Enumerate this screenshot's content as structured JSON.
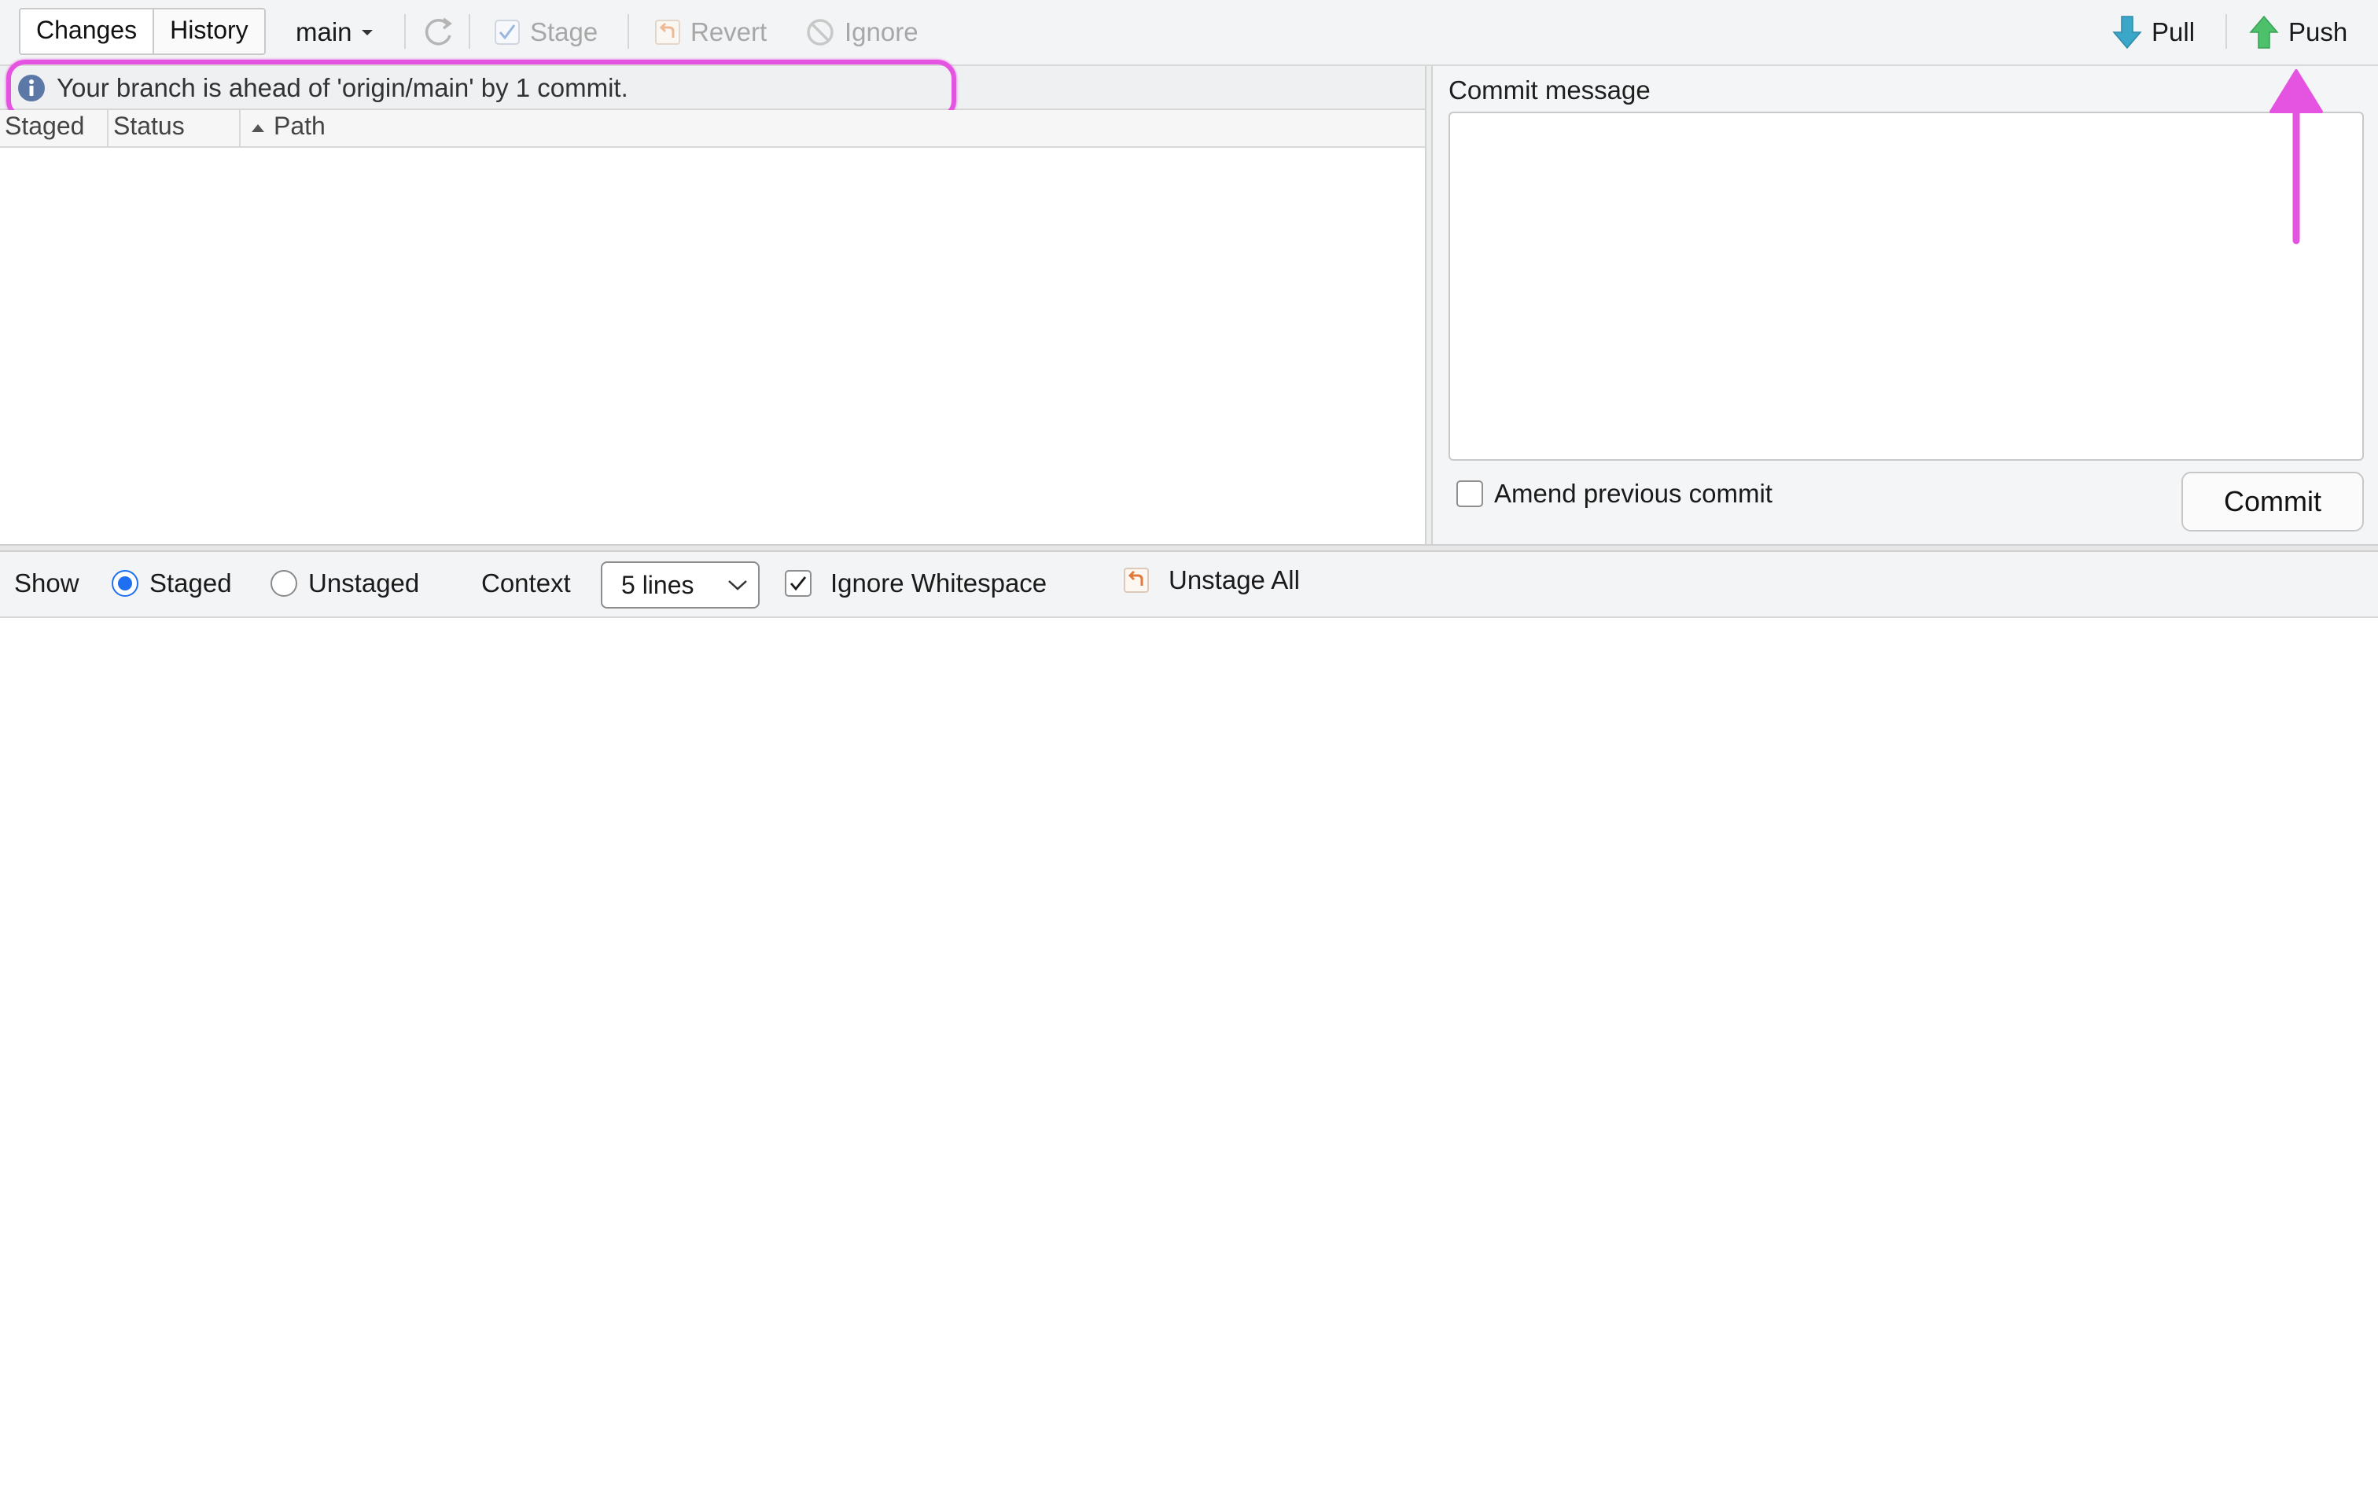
{
  "toolbar": {
    "tabs": [
      {
        "label": "Changes",
        "selected": true
      },
      {
        "label": "History",
        "selected": false
      }
    ],
    "branch": "main",
    "stage_label": "Stage",
    "revert_label": "Revert",
    "ignore_label": "Ignore",
    "pull_label": "Pull",
    "push_label": "Push"
  },
  "status": {
    "message": "Your branch is ahead of 'origin/main' by 1 commit."
  },
  "files": {
    "columns": [
      "Staged",
      "Status",
      "Path"
    ]
  },
  "commit": {
    "label": "Commit message",
    "message_value": "",
    "amend_label": "Amend previous commit",
    "amend_checked": false,
    "button_label": "Commit"
  },
  "diff_options": {
    "show_label": "Show",
    "staged_label": "Staged",
    "unstaged_label": "Unstaged",
    "selected": "Staged",
    "context_label": "Context",
    "context_value": "5 lines",
    "ignore_whitespace_label": "Ignore Whitespace",
    "ignore_whitespace_checked": true,
    "unstage_all_label": "Unstage All"
  },
  "colors": {
    "annotation": "#e553e1",
    "pull_arrow": "#3aa7c9",
    "push_arrow": "#4cc06a",
    "radio_on": "#1f6ff1",
    "revert_icon": "#e07a3a"
  }
}
